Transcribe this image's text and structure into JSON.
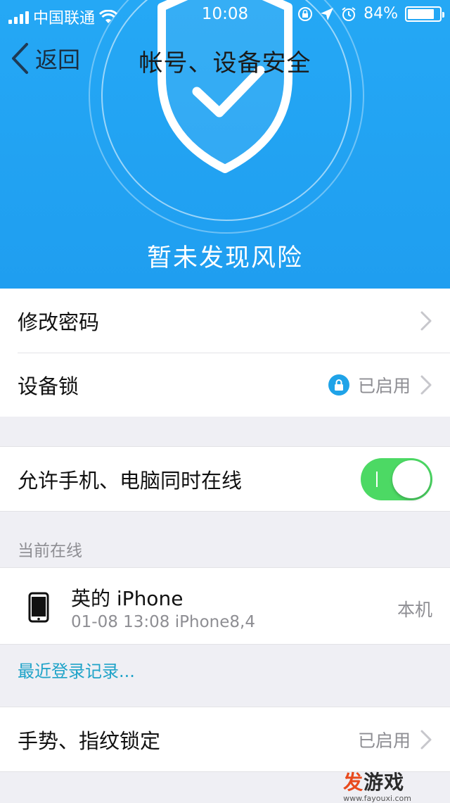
{
  "status_bar": {
    "carrier": "中国联通",
    "time": "10:08",
    "battery": "84%",
    "battery_level": 0.84
  },
  "nav": {
    "back_label": "返回",
    "title": "帐号、设备安全"
  },
  "header": {
    "risk_status": "暂未发现风险"
  },
  "rows": {
    "change_password": "修改密码",
    "device_lock": "设备锁",
    "device_lock_status": "已启用",
    "allow_simultaneous": "允许手机、电脑同时在线",
    "allow_simultaneous_on": true,
    "gesture_fingerprint": "手势、指纹锁定",
    "gesture_fingerprint_status": "已启用"
  },
  "online": {
    "section_title": "当前在线",
    "device_name": "英的 iPhone",
    "device_meta": "01-08 13:08  iPhone8,4",
    "device_tag": "本机",
    "recent_login_link": "最近登录记录..."
  },
  "watermark": {
    "brand_a": "发",
    "brand_b": "游戏",
    "domain": "www.fayouxi.com"
  },
  "colors": {
    "header_blue": "#1f9ef0",
    "toggle_green": "#4cd964",
    "link": "#1fa3c8"
  }
}
